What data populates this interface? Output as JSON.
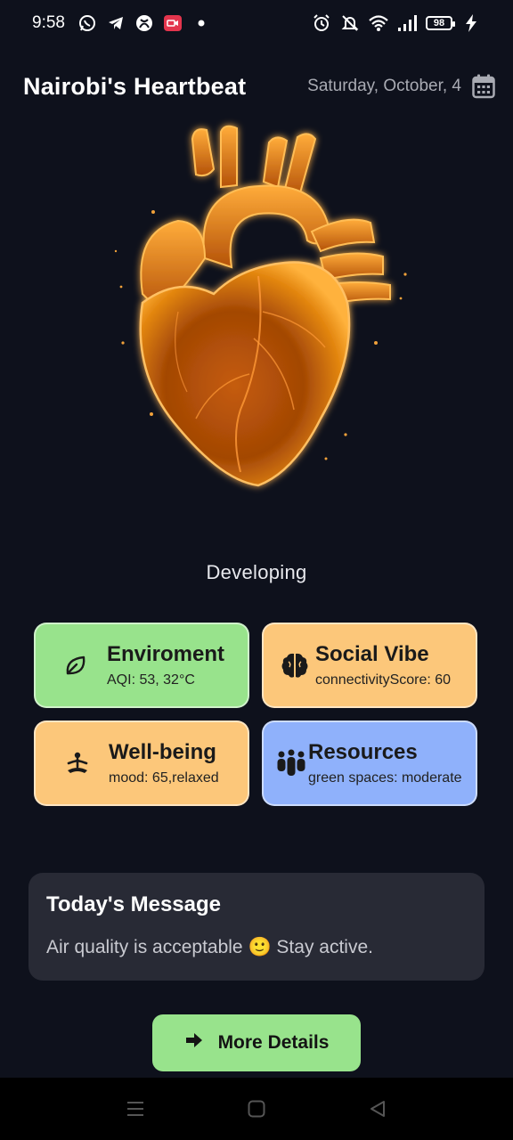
{
  "status_bar": {
    "time": "9:58",
    "battery": "98",
    "left_icons": [
      "whatsapp-icon",
      "telegram-icon",
      "xbox-icon",
      "video-record-icon",
      "dot-icon"
    ],
    "right_icons": [
      "alarm-icon",
      "notifications-off-icon",
      "wifi-icon",
      "signal-icon",
      "battery-icon",
      "charging-icon"
    ]
  },
  "header": {
    "title": "Nairobi's Heartbeat",
    "date": "Saturday, October, 4"
  },
  "heart": {
    "status": "Developing",
    "accent": "#f29a1f"
  },
  "cards": [
    {
      "title": "Enviroment",
      "subtitle": "AQI: 53, 32°C",
      "icon": "leaf-icon",
      "color": "#98e38c"
    },
    {
      "title": "Social Vibe",
      "subtitle": "connectivityScore: 60",
      "icon": "brain-icon",
      "color": "#fcc77a"
    },
    {
      "title": "Well-being",
      "subtitle": "mood: 65,relaxed",
      "icon": "meditation-icon",
      "color": "#fcc77a"
    },
    {
      "title": "Resources",
      "subtitle": "green spaces: moderate",
      "icon": "people-icon",
      "color": "#8fb1fb"
    }
  ],
  "message": {
    "title": "Today's Message",
    "text": "Air quality is acceptable 🙂 Stay active."
  },
  "button": {
    "label": "More Details",
    "icon": "arrow-right-icon"
  },
  "nav": {
    "icons": [
      "menu-icon",
      "home-icon",
      "back-icon"
    ]
  }
}
